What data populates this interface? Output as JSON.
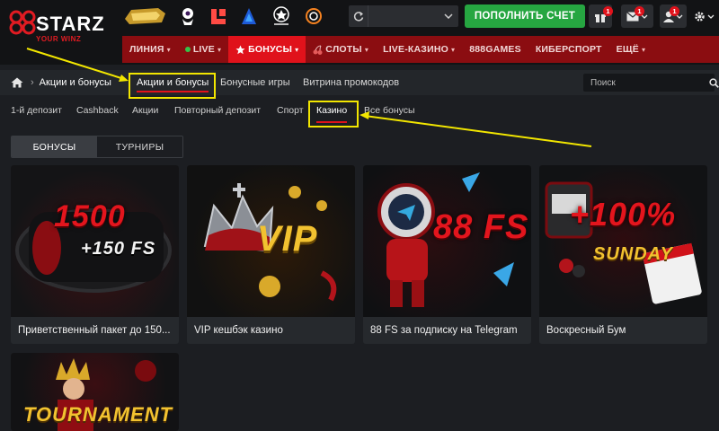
{
  "header": {
    "logo": {
      "text_prefix": "88",
      "text_main": "STARZ",
      "tagline": "YOUR WINZ"
    },
    "partners": [
      "sevilla-badge-icon",
      "premier-league-icon",
      "laliga-icon",
      "serie-a-icon",
      "champions-league-icon",
      "europa-league-icon"
    ],
    "nav": [
      {
        "label": "ЛИНИЯ",
        "active": false,
        "icon": ""
      },
      {
        "label": "LIVE",
        "active": false,
        "icon": "live-dot"
      },
      {
        "label": "БОНУСЫ",
        "active": true,
        "icon": "star-icon"
      },
      {
        "label": "СЛОТЫ",
        "active": false,
        "icon": "cherry-icon"
      },
      {
        "label": "LIVE-КАЗИНО",
        "active": false,
        "icon": ""
      },
      {
        "label": "888GAMES",
        "active": false,
        "icon": ""
      },
      {
        "label": "КИБЕРСПОРТ",
        "active": false,
        "icon": ""
      },
      {
        "label": "ЕЩЁ",
        "active": false,
        "icon": ""
      }
    ],
    "deposit_label": "ПОПОЛНИТЬ СЧЕТ",
    "gift_badge": "1",
    "mail_badge": "1",
    "user_badge": "1"
  },
  "breadcrumb": {
    "current": "Акции и бонусы",
    "tabs": [
      "Акции и бонусы",
      "Бонусные игры",
      "Витрина промокодов"
    ]
  },
  "search": {
    "placeholder": "Поиск"
  },
  "subtabs": [
    "1-й депозит",
    "Cashback",
    "Акции",
    "Повторный депозит",
    "Спорт",
    "Казино",
    "Все бонусы"
  ],
  "toggle": {
    "left": "БОНУСЫ",
    "right": "ТУРНИРЫ"
  },
  "cards": [
    {
      "title": "Приветственный пакет до 150...",
      "art_line1": "1500",
      "art_line2": "+150 FS"
    },
    {
      "title": "VIP кешбэк казино",
      "art_line1": "VIP",
      "art_line2": ""
    },
    {
      "title": "88 FS за подписку на Telegram",
      "art_line1": "88 FS",
      "art_line2": ""
    },
    {
      "title": "Воскресный Бум",
      "art_line1": "+100%",
      "art_line2": "SUNDAY"
    },
    {
      "title": "",
      "art_line1": "TOURNAMENT",
      "art_line2": ""
    }
  ],
  "colors": {
    "accent_red": "#e0121b",
    "nav_red": "#8b0d11",
    "green": "#26a641",
    "highlight": "#f2e600"
  }
}
